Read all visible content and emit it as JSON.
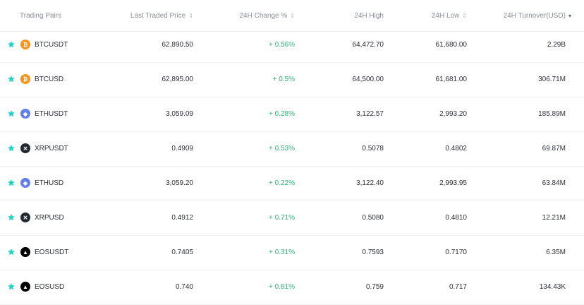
{
  "header": {
    "pair": "Trading Pairs",
    "price": "Last Traded Price",
    "change": "24H Change %",
    "high": "24H High",
    "low": "24H Low",
    "turnover": "24H Turnover(USD)"
  },
  "colors": {
    "star": "#1fd3c6",
    "positive": "#2bb673",
    "btc": "#f7931a",
    "eth": "#627eea",
    "xrp": "#23292f",
    "eos": "#000000"
  },
  "rows": [
    {
      "pair": "BTCUSDT",
      "coin": "btc",
      "icon": "bitcoin-icon",
      "price": "62,890.50",
      "change": "+ 0.56%",
      "high": "64,472.70",
      "low": "61,680.00",
      "turnover": "2.29B"
    },
    {
      "pair": "BTCUSD",
      "coin": "btc",
      "icon": "bitcoin-icon",
      "price": "62,895.00",
      "change": "+ 0.5%",
      "high": "64,500.00",
      "low": "61,681.00",
      "turnover": "306.71M"
    },
    {
      "pair": "ETHUSDT",
      "coin": "eth",
      "icon": "ethereum-icon",
      "price": "3,059.09",
      "change": "+ 0.28%",
      "high": "3,122.57",
      "low": "2,993.20",
      "turnover": "185.89M"
    },
    {
      "pair": "XRPUSDT",
      "coin": "xrp",
      "icon": "xrp-icon",
      "price": "0.4909",
      "change": "+ 0.53%",
      "high": "0.5078",
      "low": "0.4802",
      "turnover": "69.87M"
    },
    {
      "pair": "ETHUSD",
      "coin": "eth",
      "icon": "ethereum-icon",
      "price": "3,059.20",
      "change": "+ 0.22%",
      "high": "3,122.40",
      "low": "2,993.95",
      "turnover": "63.84M"
    },
    {
      "pair": "XRPUSD",
      "coin": "xrp",
      "icon": "xrp-icon",
      "price": "0.4912",
      "change": "+ 0.71%",
      "high": "0.5080",
      "low": "0.4810",
      "turnover": "12.21M"
    },
    {
      "pair": "EOSUSDT",
      "coin": "eos",
      "icon": "eos-icon",
      "price": "0.7405",
      "change": "+ 0.31%",
      "high": "0.7593",
      "low": "0.7170",
      "turnover": "6.35M"
    },
    {
      "pair": "EOSUSD",
      "coin": "eos",
      "icon": "eos-icon",
      "price": "0.740",
      "change": "+ 0.81%",
      "high": "0.759",
      "low": "0.717",
      "turnover": "134.43K"
    }
  ]
}
